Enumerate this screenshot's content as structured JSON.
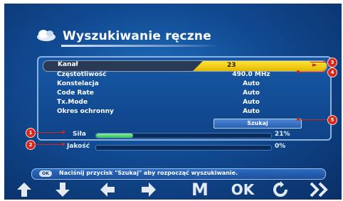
{
  "header": {
    "title": "Wyszukiwanie ręczne",
    "icon": "satellite-dish-icon"
  },
  "form": {
    "rows": [
      {
        "label": "Kanał",
        "value": "23"
      },
      {
        "label": "Częstotliwość",
        "value": "490.0 MHz"
      },
      {
        "label": "Konstelacja",
        "value": "Auto"
      },
      {
        "label": "Code Rate",
        "value": "Auto"
      },
      {
        "label": "Tx.Mode",
        "value": "Auto"
      },
      {
        "label": "Okres ochronny",
        "value": "Auto"
      }
    ],
    "search_button": "Szukaj"
  },
  "signal": {
    "strength": {
      "label": "Siła",
      "percent_text": "21%",
      "percent": 21
    },
    "quality": {
      "label": "Jakość",
      "percent_text": "0%",
      "percent": 0
    }
  },
  "callouts": [
    "1",
    "2",
    "3",
    "4",
    "5"
  ],
  "hint": {
    "key": "OK",
    "text": "Naciśnij przycisk \"Szukaj\" aby rozpocząć wyszukiwanie."
  },
  "bottom_keys": [
    "arrow-up-icon",
    "arrow-down-icon",
    "arrow-left-icon",
    "arrow-right-icon",
    "M",
    "OK",
    "refresh-icon",
    "double-chevron-right-icon"
  ],
  "colors": {
    "accent_yellow": "#f2c91a",
    "callout_red": "#d7261a",
    "panel_blue": "#1758a6"
  }
}
